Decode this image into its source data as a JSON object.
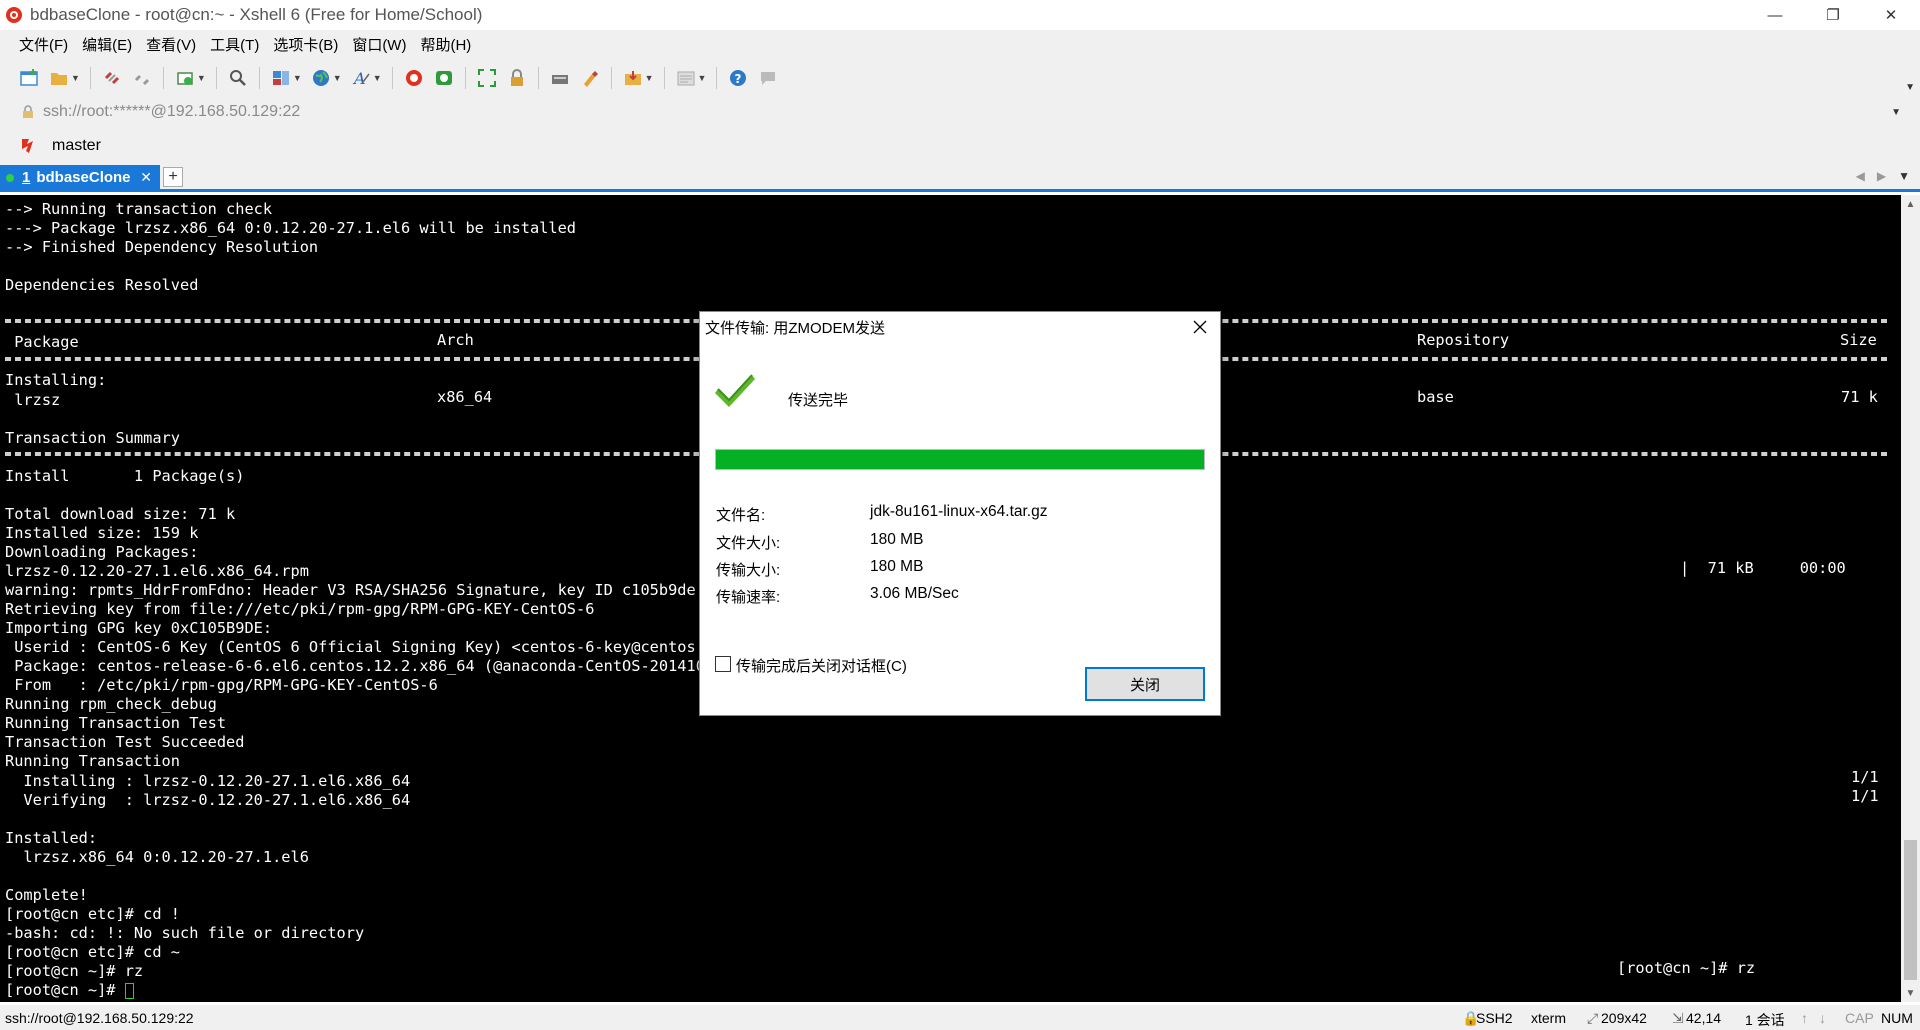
{
  "window": {
    "title": "bdbaseClone - root@cn:~ - Xshell 6 (Free for Home/School)",
    "minimize": "—",
    "restore": "❐",
    "close": "✕"
  },
  "menu": [
    "文件(F)",
    "编辑(E)",
    "查看(V)",
    "工具(T)",
    "选项卡(B)",
    "窗口(W)",
    "帮助(H)"
  ],
  "address": {
    "text": "ssh://root:******@192.168.50.129:22"
  },
  "session_bar": {
    "label": "master"
  },
  "tabs": [
    {
      "number": "1",
      "label": "bdbaseClone",
      "close": "✕"
    }
  ],
  "add_tab": "+",
  "terminal": {
    "lines": [
      "--> Running transaction check",
      "---> Package lrzsz.x86_64 0:0.12.20-27.1.el6 will be installed",
      "--> Finished Dependency Resolution",
      "",
      "Dependencies Resolved",
      "",
      "",
      " Package",
      "",
      "Installing:",
      " lrzsz",
      "",
      "Transaction Summary",
      "",
      "Install       1 Package(s)",
      "",
      "Total download size: 71 k",
      "Installed size: 159 k",
      "Downloading Packages:",
      "lrzsz-0.12.20-27.1.el6.x86_64.rpm",
      "warning: rpmts_HdrFromFdno: Header V3 RSA/SHA256 Signature, key ID c105b9de: ",
      "Retrieving key from file:///etc/pki/rpm-gpg/RPM-GPG-KEY-CentOS-6",
      "Importing GPG key 0xC105B9DE:",
      " Userid : CentOS-6 Key (CentOS 6 Official Signing Key) <centos-6-key@centos.o",
      " Package: centos-release-6-6.el6.centos.12.2.x86_64 (@anaconda-CentOS-2014102",
      " From   : /etc/pki/rpm-gpg/RPM-GPG-KEY-CentOS-6",
      "Running rpm_check_debug",
      "Running Transaction Test",
      "Transaction Test Succeeded",
      "Running Transaction",
      "  Installing : lrzsz-0.12.20-27.1.el6.x86_64",
      "  Verifying  : lrzsz-0.12.20-27.1.el6.x86_64",
      "",
      "Installed:",
      "  lrzsz.x86_64 0:0.12.20-27.1.el6",
      "",
      "Complete!",
      "[root@cn etc]# cd !",
      "-bash: cd: !: No such file or directory",
      "[root@cn etc]# cd ~",
      "[root@cn ~]# rz",
      "[root@cn ~]# "
    ],
    "arch_header": "Arch",
    "arch_value": "x86_64",
    "repo_header": "Repository",
    "repo_value": "base",
    "size_header": "Size",
    "size_value": "71 k",
    "download_progress": "|  71 kB     00:00",
    "installing_count": "1/1",
    "verifying_count": "1/1",
    "rz_echo": "[root@cn ~]# rz"
  },
  "dialog": {
    "title": "文件传输: 用ZMODEM发送",
    "status": "传送完毕",
    "progress": 1.0,
    "rows": [
      {
        "label": "文件名:",
        "value": "jdk-8u161-linux-x64.tar.gz"
      },
      {
        "label": "文件大小:",
        "value": "180 MB"
      },
      {
        "label": "传输大小:",
        "value": "180 MB"
      },
      {
        "label": "传输速率:",
        "value": "3.06 MB/Sec"
      }
    ],
    "checkbox_label": "传输完成后关闭对话框(C)",
    "close_button": "关闭",
    "progress_color": "#06b025"
  },
  "status_bar": {
    "connection": "ssh://root@192.168.50.129:22",
    "protocol": "SSH2",
    "term": "xterm",
    "size": "209x42",
    "cursor": "42,14",
    "sessions": "1 会话",
    "caps": "CAP",
    "num": "NUM"
  },
  "colors": {
    "accent": "#1a78d8",
    "terminal_bg": "#000000",
    "terminal_fg": "#ffffff",
    "success": "#06b025"
  }
}
